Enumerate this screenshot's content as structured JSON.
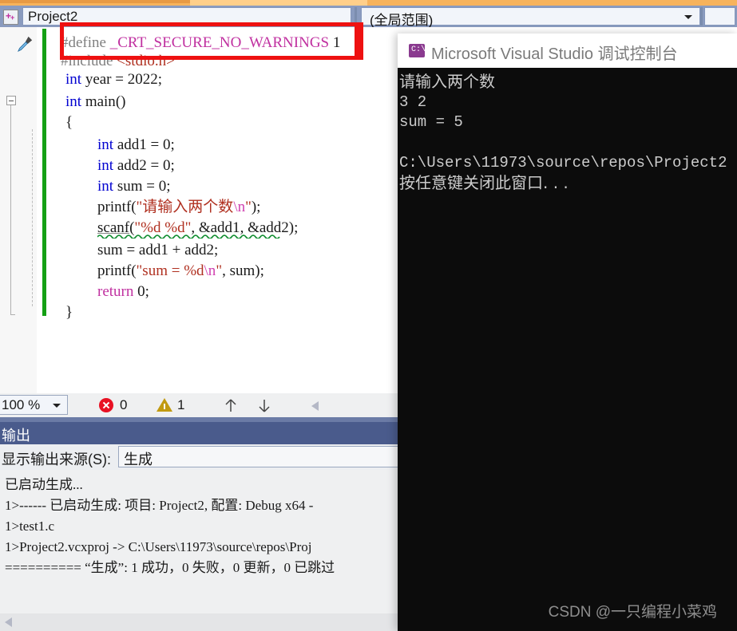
{
  "window": {
    "ide_name": "Microsoft Visual Studio",
    "project_name": "Project2",
    "scope_selector": "(全局范围)"
  },
  "editor": {
    "zoom_level": "100 %",
    "error_count": "0",
    "warning_count": "1",
    "filename": "test1.c",
    "code_lines": [
      {
        "indent": 0,
        "text": "#define _CRT_SECURE_NO_WARNINGS 1"
      },
      {
        "indent": 0,
        "text": "#include <stdio.h>"
      },
      {
        "indent": 0,
        "text": "int year = 2022;"
      },
      {
        "indent": 0,
        "text": "int main()"
      },
      {
        "indent": 0,
        "text": "{"
      },
      {
        "indent": 1,
        "text": "int add1 = 0;"
      },
      {
        "indent": 1,
        "text": "int add2 = 0;"
      },
      {
        "indent": 1,
        "text": "int sum = 0;"
      },
      {
        "indent": 1,
        "text": "printf(\"请输入两个数\\n\");"
      },
      {
        "indent": 1,
        "text": "scanf(\"%d %d\", &add1, &add2);"
      },
      {
        "indent": 1,
        "text": "sum = add1 + add2;"
      },
      {
        "indent": 1,
        "text": "printf(\"sum = %d\\n\", sum);"
      },
      {
        "indent": 1,
        "text": "return 0;"
      },
      {
        "indent": 0,
        "text": "}"
      }
    ],
    "tokens": {
      "preproc_define": "#define",
      "macro_name": "_CRT_SECURE_NO_WARNINGS",
      "macro_value": "1",
      "preproc_include": "#include",
      "include_target": "<stdio.h>",
      "kw_int": "int",
      "kw_return": "return",
      "global_var": "year",
      "global_var_value": "2022",
      "fn_main": "main()",
      "var_add1": "add1",
      "var_add2": "add2",
      "var_sum": "sum",
      "fn_printf": "printf",
      "fn_scanf": "scanf",
      "str_prompt": "请输入两个数",
      "str_scanf_fmt": "%d %d",
      "str_sum_fmt": "sum = %d",
      "escape_n": "\\n",
      "zero": "0"
    }
  },
  "output_panel": {
    "title": "输出",
    "source_label": "显示输出来源(S):",
    "source_value": "生成",
    "lines": [
      "已启动生成...",
      "1>------ 已启动生成: 项目: Project2, 配置: Debug x64 -",
      "1>test1.c",
      "1>Project2.vcxproj -> C:\\Users\\11973\\source\\repos\\Proj",
      "========== “生成”: 1 成功，0 失败，0 更新，0 已跳过"
    ]
  },
  "console_window": {
    "title": "Microsoft Visual Studio 调试控制台",
    "lines": [
      "请输入两个数",
      "3 2",
      "sum = 5",
      "",
      "C:\\Users\\11973\\source\\repos\\Project2",
      "按任意键关闭此窗口. . ."
    ]
  },
  "watermark": "CSDN @一只编程小菜鸡",
  "colors": {
    "keyword_blue": "#0000d0",
    "macro_magenta": "#c030a0",
    "string_red": "#b03020",
    "preproc_grey": "#808080",
    "annotation_red": "#ee1111",
    "save_indicator_green": "#14a014",
    "output_header_blue": "#4a5b8c",
    "console_bg": "#0c0c0c"
  }
}
